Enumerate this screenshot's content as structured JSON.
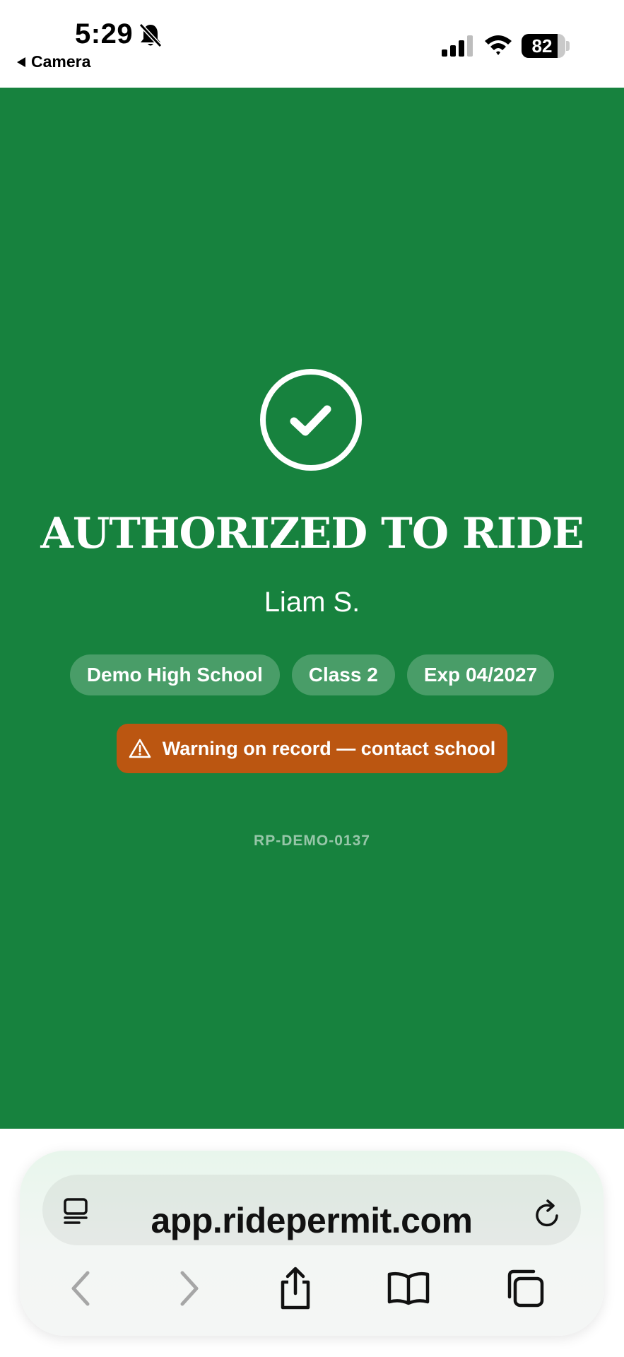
{
  "status_bar": {
    "time": "5:29",
    "back_app": "Camera",
    "battery": "82"
  },
  "result": {
    "title": "AUTHORIZED TO RIDE",
    "rider_name": "Liam S.",
    "chips": [
      "Demo High School",
      "Class 2",
      "Exp 04/2027"
    ],
    "warning": "Warning on record — contact school",
    "permit_id": "RP-DEMO-0137"
  },
  "browser": {
    "url": "app.ridepermit.com"
  },
  "colors": {
    "authorized_green": "#17823e",
    "warning_orange": "#bb5611"
  }
}
